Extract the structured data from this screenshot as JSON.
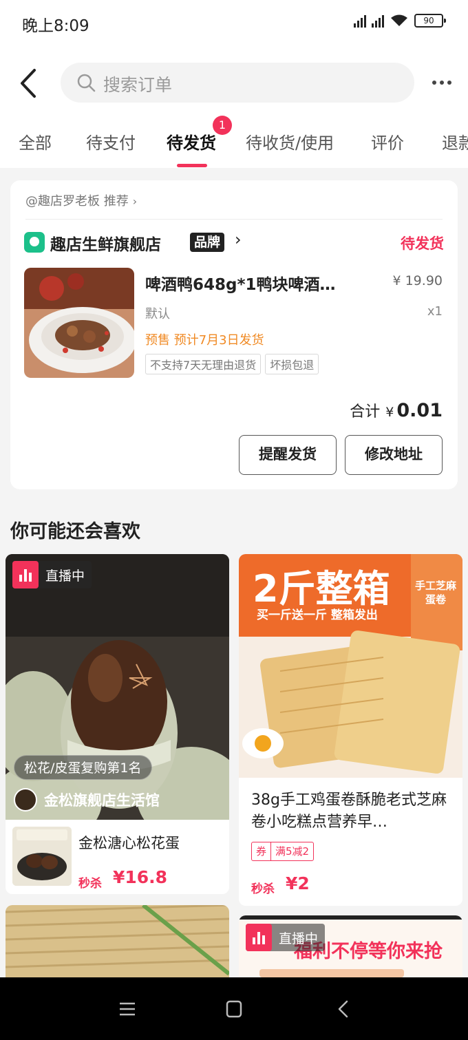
{
  "status_bar": {
    "time": "晚上8:09",
    "battery": "90"
  },
  "header": {
    "search_placeholder": "搜索订单"
  },
  "tabs": {
    "items": [
      "全部",
      "待支付",
      "待发货",
      "待收货/使用",
      "评价",
      "退款"
    ],
    "active_index": 2,
    "badge": "1"
  },
  "order": {
    "recommend_line": "@趣店罗老板 推荐",
    "store_name": "趣店生鲜旗舰店",
    "brand_tag": "品牌",
    "status": "待发货",
    "product": {
      "name": "啤酒鸭648g*1鸭块啤酒…",
      "price": "¥ 19.90",
      "spec": "默认",
      "quantity": "x1",
      "presale": "预售 预计7月3日发货",
      "service_tags": [
        "不支持7天无理由退货",
        "坏损包退"
      ]
    },
    "total_label": "合计",
    "total_currency": "¥",
    "total_amount": "0.01",
    "buttons": {
      "remind": "提醒发货",
      "change_address": "修改地址"
    }
  },
  "recommendations": {
    "title": "你可能还会喜欢",
    "live_label": "直播中",
    "items": [
      {
        "tag": "松花/皮蛋复购第1名",
        "shop": "金松旗舰店生活馆",
        "name": "金松溏心松花蛋",
        "flash_label": "秒杀",
        "price": "¥16.8"
      },
      {
        "banner_title": "2斤整箱",
        "banner_sub": "买一斤送一斤 整箱发出",
        "banner_side": "手工芝麻蛋卷",
        "title": "38g手工鸡蛋卷酥脆老式芝麻卷小吃糕点营养早…",
        "coupon_label": "券",
        "coupon_text": "满5减2",
        "flash_label": "秒杀",
        "price": "¥2"
      },
      {
        "banner": "福利不停等你来抢"
      }
    ]
  },
  "colors": {
    "accent": "#f2325a",
    "presale": "#f08a24",
    "store_logo": "#1cc08a"
  }
}
